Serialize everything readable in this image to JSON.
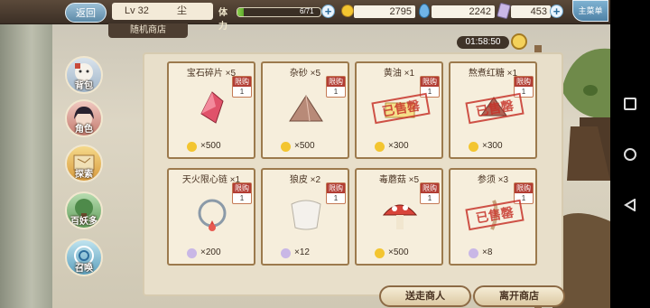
{
  "header": {
    "back_label": "返回",
    "level": "Lv 32",
    "player_name": "尘",
    "stamina_label": "体力",
    "stamina_value": "6/71",
    "stamina_fraction": 0.08,
    "gold": "2795",
    "gems": "2242",
    "crystals": "453",
    "main_menu_label": "主菜单"
  },
  "breadcrumb": "随机商店",
  "timer": "01:58:50",
  "side_nav": [
    {
      "label": "背包"
    },
    {
      "label": "角色"
    },
    {
      "label": "探索"
    },
    {
      "label": "百妖多"
    },
    {
      "label": "召唤"
    }
  ],
  "shop": {
    "limit_label": "限购",
    "sold_label": "已售罄",
    "items": [
      {
        "name": "宝石碎片 ×5",
        "limit": "1",
        "price": "×500",
        "currency": "gold",
        "sold": false,
        "art": "gem"
      },
      {
        "name": "杂砂 ×5",
        "limit": "1",
        "price": "×500",
        "currency": "gold",
        "sold": false,
        "art": "sand"
      },
      {
        "name": "黄油 ×1",
        "limit": "1",
        "price": "×300",
        "currency": "gold",
        "sold": true,
        "art": "butter"
      },
      {
        "name": "熬煮红糖 ×1",
        "limit": "1",
        "price": "×300",
        "currency": "gold",
        "sold": true,
        "art": "sugar"
      },
      {
        "name": "天火限心链 ×1",
        "limit": "1",
        "price": "×200",
        "currency": "crystal",
        "sold": false,
        "art": "necklace"
      },
      {
        "name": "狼皮 ×2",
        "limit": "1",
        "price": "×12",
        "currency": "crystal",
        "sold": false,
        "art": "pelt"
      },
      {
        "name": "毒蘑菇 ×5",
        "limit": "1",
        "price": "×500",
        "currency": "gold",
        "sold": false,
        "art": "mushroom"
      },
      {
        "name": "参须 ×3",
        "limit": "1",
        "price": "×8",
        "currency": "crystal",
        "sold": true,
        "art": "root"
      }
    ]
  },
  "buttons": {
    "send_merchant": "送走商人",
    "leave_shop": "离开商店"
  },
  "colors": {
    "gold": "#f3c530",
    "crystal": "#c9b7e6",
    "gem": "#6fb4e8",
    "limit_red": "#b23d34",
    "sold_red": "#c8362d"
  }
}
